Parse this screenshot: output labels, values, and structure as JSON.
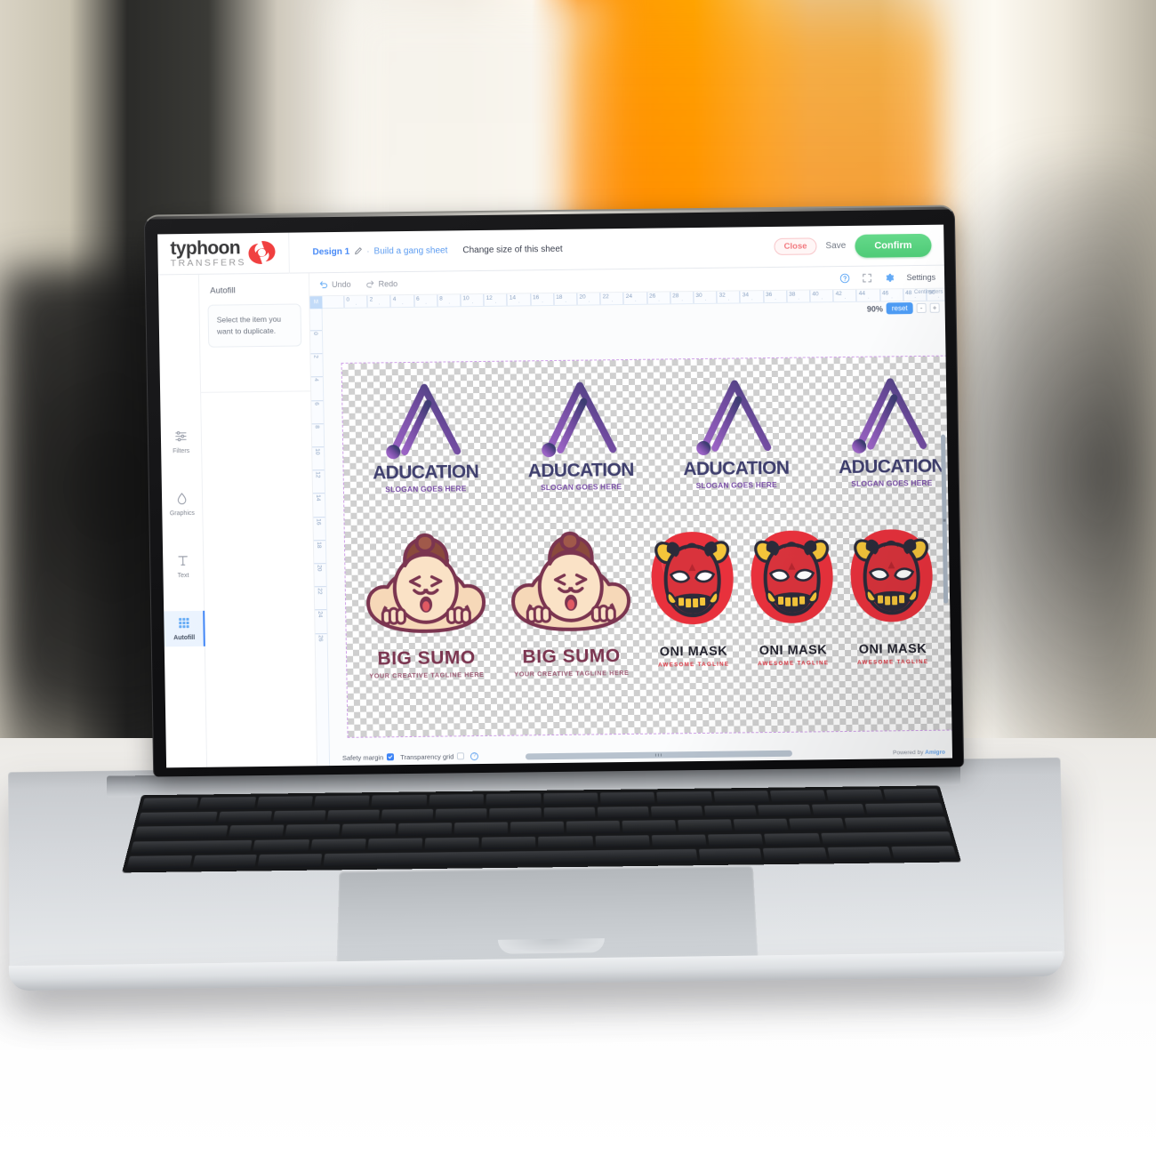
{
  "brand": {
    "name": "typhoon",
    "subtitle": "TRANSFERS",
    "mark": "typhoon-swirl-icon"
  },
  "header": {
    "design_label": "Design 1",
    "edit_icon": "pencil-icon",
    "separator": "·",
    "build_link": "Build a gang sheet",
    "change_size_link": "Change size of this sheet",
    "close_label": "Close",
    "save_label": "Save",
    "confirm_label": "Confirm",
    "accent_confirm": "#4ecb77",
    "accent_close": "#f2797f",
    "accent_link": "#5b9bf0"
  },
  "rail": {
    "items": [
      {
        "label": "Filters",
        "icon": "sliders-icon",
        "active": false
      },
      {
        "label": "Graphics",
        "icon": "droplet-icon",
        "active": false
      },
      {
        "label": "Text",
        "icon": "text-t-icon",
        "active": false
      },
      {
        "label": "Autofill",
        "icon": "grid-icon",
        "active": true
      }
    ]
  },
  "panel": {
    "title": "Autofill",
    "hint": "Select the item you want to duplicate."
  },
  "toolbar": {
    "undo_label": "Undo",
    "undo_icon": "undo-arrow-icon",
    "redo_label": "Redo",
    "redo_icon": "redo-arrow-icon",
    "help_icon": "question-circle-icon",
    "fullscreen_icon": "expand-frame-icon",
    "settings_icon": "gear-icon",
    "settings_label": "Settings"
  },
  "zoom": {
    "value": "90%",
    "reset_label": "reset",
    "minus_label": "-",
    "plus_label": "+"
  },
  "rulers": {
    "corner_label": "M",
    "unit_label": "Centimeters",
    "horizontal_ticks": [
      "0",
      "2",
      "4",
      "6",
      "8",
      "10",
      "12",
      "14",
      "16",
      "18",
      "20",
      "22",
      "24",
      "26",
      "28",
      "30",
      "32",
      "34",
      "36",
      "38",
      "40",
      "42",
      "44",
      "46",
      "48",
      "50"
    ],
    "vertical_ticks": [
      "0",
      "2",
      "4",
      "6",
      "8",
      "10",
      "12",
      "14",
      "16",
      "18",
      "20",
      "22",
      "24",
      "26"
    ]
  },
  "bottom_bar": {
    "safety_margin_label": "Safety margin",
    "safety_margin_checked": true,
    "transparency_grid_label": "Transparency grid",
    "transparency_grid_checked": false,
    "help_icon": "question-circle-icon",
    "powered_prefix": "Powered by ",
    "powered_brand": "Amigro"
  },
  "sheet": {
    "education_logos": [
      {
        "title": "ADUCATION",
        "slogan": "SLOGAN GOES HERE"
      },
      {
        "title": "ADUCATION",
        "slogan": "SLOGAN GOES HERE"
      },
      {
        "title": "ADUCATION",
        "slogan": "SLOGAN GOES HERE"
      },
      {
        "title": "ADUCATION",
        "slogan": "SLOGAN GOES HERE"
      }
    ],
    "sumo_logos": [
      {
        "title": "BIG SUMO",
        "tagline": "YOUR CREATIVE TAGLINE HERE"
      },
      {
        "title": "BIG SUMO",
        "tagline": "YOUR CREATIVE TAGLINE HERE"
      }
    ],
    "oni_logos": [
      {
        "title": "ONI MASK",
        "tagline": "AWESOME TAGLINE"
      },
      {
        "title": "ONI MASK",
        "tagline": "AWESOME TAGLINE"
      },
      {
        "title": "ONI MASK",
        "tagline": "AWESOME TAGLINE"
      }
    ],
    "colors": {
      "a_mark_dark": "#3f3f6e",
      "a_mark_light": "#8a59b0",
      "a_title": "#3f3f6e",
      "a_slogan": "#7a4fa8",
      "sumo_title": "#7b3550",
      "sumo_tagline": "#9c5b74",
      "oni_title": "#23232e",
      "oni_tagline": "#d8333f",
      "oni_red": "#e8313c"
    }
  }
}
